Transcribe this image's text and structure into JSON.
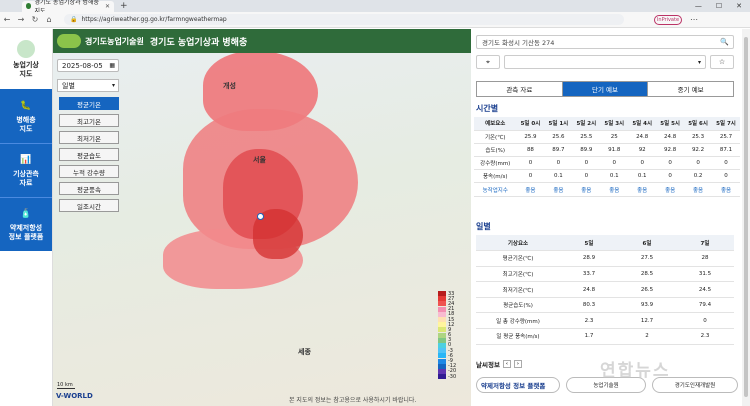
{
  "browser": {
    "tab_title": "경기도 농업기상과 병해충 지도",
    "url": "https://agriweather.gg.go.kr/farmngweathermap",
    "profile": "InPrivate"
  },
  "sidebar": {
    "items": [
      {
        "label": "농업기상\n지도",
        "icon": "map-icon"
      },
      {
        "label": "병해충\n지도",
        "icon": "bug-icon"
      },
      {
        "label": "기상관측\n자료",
        "icon": "chart-icon"
      },
      {
        "label": "약제저항성\n정보 플랫폼",
        "icon": "bottle-icon"
      }
    ]
  },
  "map": {
    "header_logo": "경기도농업기술원",
    "header_title": "경기도 농업기상과 병해충",
    "date": "2025-08-05",
    "period": "일별",
    "options": [
      "평균기온",
      "최고기온",
      "최저기온",
      "평균습도",
      "누적 강수량",
      "평균풍속",
      "일조시간"
    ],
    "active_option": "평균기온",
    "cities": [
      "개성",
      "서울",
      "세종"
    ],
    "legend": {
      "values": [
        "33",
        "27",
        "24",
        "21",
        "18",
        "15",
        "12",
        "9",
        "6",
        "3",
        "0",
        "-3",
        "-6",
        "-9",
        "-12",
        "-20",
        "-30"
      ],
      "colors": [
        "#b71c1c",
        "#e53935",
        "#ef5350",
        "#f48fb1",
        "#f8bbd0",
        "#ffe0b2",
        "#fff59d",
        "#dce775",
        "#aed581",
        "#81c784",
        "#4dd0e1",
        "#4fc3f7",
        "#29b6f6",
        "#1e88e5",
        "#1565c0",
        "#5e35b1",
        "#311b92"
      ]
    },
    "scale_label": "10 km",
    "vworld": "V-WORLD",
    "copyright": "본 지도의 정보는 참고용으로 사용하시기 바랍니다."
  },
  "panel": {
    "address": "경기도 화성시 기산동 274",
    "tabs": [
      "관측 자료",
      "단기 예보",
      "중기 예보"
    ],
    "active_tab": "단기 예보",
    "hourly_title": "시간별",
    "hourly": {
      "headers": [
        "예보요소",
        "5일 0시",
        "5일 1시",
        "5일 2시",
        "5일 3시",
        "5일 4시",
        "5일 5시",
        "5일 6시",
        "5일 7시"
      ],
      "rows": [
        [
          "기온(℃)",
          "25.9",
          "25.6",
          "25.5",
          "25",
          "24.8",
          "24.8",
          "25.3",
          "25.7"
        ],
        [
          "습도(%)",
          "88",
          "89.7",
          "89.9",
          "91.8",
          "92",
          "92.8",
          "92.2",
          "87.1"
        ],
        [
          "강수량(mm)",
          "0",
          "0",
          "0",
          "0",
          "0",
          "0",
          "0",
          "0"
        ],
        [
          "풍속(m/s)",
          "0",
          "0.1",
          "0",
          "0.1",
          "0.1",
          "0",
          "0.2",
          "0"
        ],
        [
          "농작업지수",
          "좋음",
          "좋음",
          "좋음",
          "좋음",
          "좋음",
          "좋음",
          "좋음",
          "좋음"
        ]
      ]
    },
    "daily_title": "일별",
    "daily": {
      "headers": [
        "기상요소",
        "5일",
        "6일",
        "7일"
      ],
      "rows": [
        [
          "평균기온(℃)",
          "28.9",
          "27.5",
          "28"
        ],
        [
          "최고기온(℃)",
          "33.7",
          "28.5",
          "31.5"
        ],
        [
          "최저기온(℃)",
          "24.8",
          "26.5",
          "24.5"
        ],
        [
          "평균습도(%)",
          "80.3",
          "93.9",
          "79.4"
        ],
        [
          "일 총 강수량(mm)",
          "2.3",
          "12.7",
          "0"
        ],
        [
          "일 평균 풍속(m/s)",
          "1.7",
          "2",
          "2.3"
        ]
      ]
    },
    "weather_title": "날씨정보",
    "bottom_buttons": [
      "약제저항성 정보 플랫폼",
      "농업기술원",
      "경기도인재개발원"
    ]
  },
  "watermark": "연합뉴스"
}
